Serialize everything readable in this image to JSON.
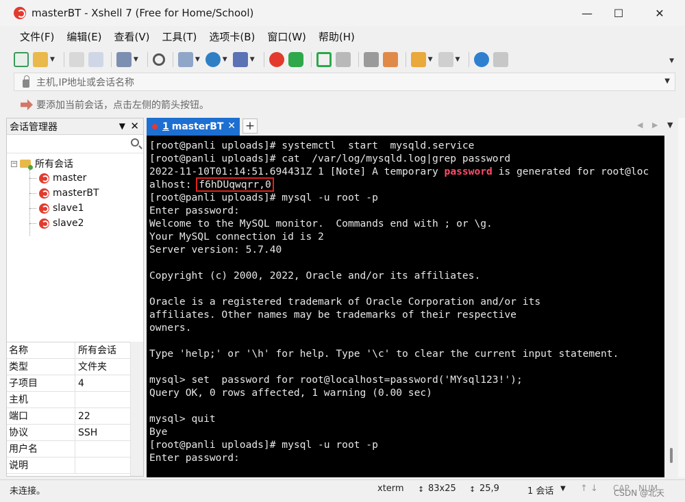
{
  "window": {
    "title": "masterBT - Xshell 7 (Free for Home/School)"
  },
  "menu": [
    "文件(F)",
    "编辑(E)",
    "查看(V)",
    "工具(T)",
    "选项卡(B)",
    "窗口(W)",
    "帮助(H)"
  ],
  "address": {
    "placeholder": "主机,IP地址或会话名称"
  },
  "hint": {
    "text": "要添加当前会话，点击左侧的箭头按钮。"
  },
  "session_manager": {
    "title": "会话管理器",
    "root": "所有会话",
    "sessions": [
      "master",
      "masterBT",
      "slave1",
      "slave2"
    ],
    "properties": [
      {
        "key": "名称",
        "value": "所有会话"
      },
      {
        "key": "类型",
        "value": "文件夹"
      },
      {
        "key": "子项目",
        "value": "4"
      },
      {
        "key": "主机",
        "value": ""
      },
      {
        "key": "端口",
        "value": "22"
      },
      {
        "key": "协议",
        "value": "SSH"
      },
      {
        "key": "用户名",
        "value": ""
      },
      {
        "key": "说明",
        "value": ""
      }
    ]
  },
  "tab": {
    "number": "1",
    "name": "masterBT"
  },
  "terminal": {
    "l1": "[root@panli uploads]# systemctl  start  mysqld.service",
    "l2": "[root@panli uploads]# cat  /var/log/mysqld.log|grep password",
    "l3a": "2022-11-10T01:14:51.694431Z 1 [Note] A temporary ",
    "l3b": "password",
    "l3c": " is generated for root@loc",
    "l4a": "alhost: ",
    "l4b": "f6hDUqwqrr,0",
    "l5": "[root@panli uploads]# mysql -u root -p",
    "l6": "Enter password:",
    "l7": "Welcome to the MySQL monitor.  Commands end with ; or \\g.",
    "l8": "Your MySQL connection id is 2",
    "l9": "Server version: 5.7.40",
    "l10": "",
    "l11": "Copyright (c) 2000, 2022, Oracle and/or its affiliates.",
    "l12": "",
    "l13": "Oracle is a registered trademark of Oracle Corporation and/or its",
    "l14": "affiliates. Other names may be trademarks of their respective",
    "l15": "owners.",
    "l16": "",
    "l17": "Type 'help;' or '\\h' for help. Type '\\c' to clear the current input statement.",
    "l18": "",
    "l19": "mysql> set  password for root@localhost=password('MYsql123!');",
    "l20": "Query OK, 0 rows affected, 1 warning (0.00 sec)",
    "l21": "",
    "l22": "mysql> quit",
    "l23": "Bye",
    "l24": "[root@panli uploads]# mysql -u root -p",
    "l25": "Enter password:"
  },
  "status": {
    "connection": "未连接。",
    "term_type": "xterm",
    "size": "83x25",
    "cursor": "25,9",
    "sessions": "1 会话",
    "caps": "CAP",
    "num": "NUM",
    "watermark": "CSDN @北天"
  },
  "colors": {
    "tab_active": "#1d6fd1",
    "highlight": "#ff4d6a",
    "box": "#e0231b"
  }
}
